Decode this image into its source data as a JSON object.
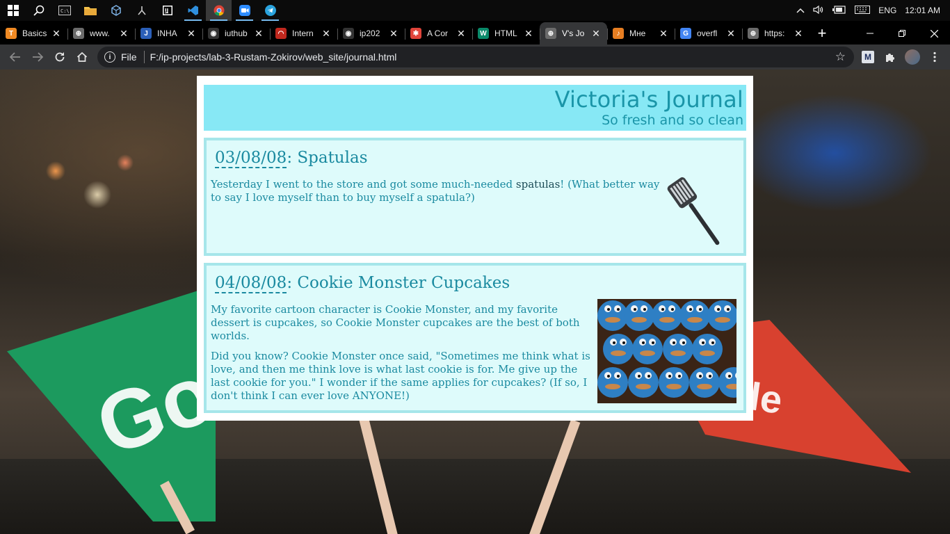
{
  "taskbar": {
    "tray": {
      "language": "ENG",
      "time": "12:01 AM"
    }
  },
  "tabs": [
    {
      "title": "Basics",
      "color": "#f08a24",
      "glyph": "T"
    },
    {
      "title": "www.",
      "color": "#6b6b6b",
      "glyph": "⊕"
    },
    {
      "title": "INHA",
      "color": "#2b5fb8",
      "glyph": "J"
    },
    {
      "title": "iuthub",
      "color": "#333333",
      "glyph": "◉"
    },
    {
      "title": "Intern",
      "color": "#c0281e",
      "glyph": "◠"
    },
    {
      "title": "ip202",
      "color": "#333333",
      "glyph": "◉"
    },
    {
      "title": "A Cor",
      "color": "#e0443a",
      "glyph": "✱"
    },
    {
      "title": "HTML",
      "color": "#0a8a6a",
      "glyph": "W"
    },
    {
      "title": "V's Jo",
      "color": "#6b6b6b",
      "glyph": "⊕",
      "active": true
    },
    {
      "title": "Мне",
      "color": "#e67e22",
      "glyph": "♪"
    },
    {
      "title": "overfl",
      "color": "#4285f4",
      "glyph": "G"
    },
    {
      "title": "https:",
      "color": "#6b6b6b",
      "glyph": "⊕"
    }
  ],
  "toolbar": {
    "file_label": "File",
    "url": "F:/ip-projects/lab-3-Rustam-Zokirov/web_site/journal.html",
    "extension_label": "M"
  },
  "journal": {
    "title": "Victoria's Journal",
    "tagline": "So fresh and so clean",
    "entries": [
      {
        "date": "03/08/08",
        "heading": ": Spatulas",
        "p1_a": "Yesterday I went to the store and got some much-needed ",
        "p1_b": "spatulas",
        "p1_c": "! (What better way to say I love myself than to buy myself a spatula?)"
      },
      {
        "date": "04/08/08",
        "heading": ": Cookie Monster Cupcakes",
        "p1": "My favorite cartoon character is Cookie Monster, and my favorite dessert is cupcakes, so Cookie Monster cupcakes are the best of both worlds.",
        "p2": "Did you know? Cookie Monster once said, \"Sometimes me think what is love, and then me think love is what last cookie is for. Me give up the last cookie for you.\" I wonder if the same applies for cupcakes? (If so, I don't think I can ever love ANYONE!)"
      }
    ]
  },
  "background": {
    "flag_green_text": "Go",
    "flag_red_text": "le"
  }
}
